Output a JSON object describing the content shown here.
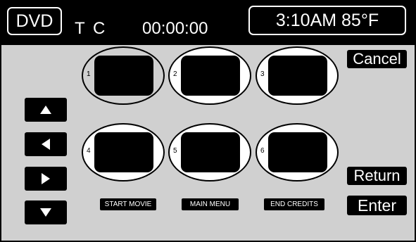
{
  "header": {
    "source_label": "DVD",
    "title_marker": "T",
    "chapter_marker": "C",
    "elapsed_time": "00:00:00",
    "clock_temperature": "3:10AM 85°F"
  },
  "buttons": {
    "cancel": "Cancel",
    "return": "Return",
    "enter": "Enter"
  },
  "arrows": [
    "up-arrow-icon",
    "left-arrow-icon",
    "right-arrow-icon",
    "down-arrow-icon"
  ],
  "chapters": [
    {
      "number": "1",
      "selected": true
    },
    {
      "number": "2",
      "selected": false
    },
    {
      "number": "3",
      "selected": false
    },
    {
      "number": "4",
      "selected": false
    },
    {
      "number": "5",
      "selected": false
    },
    {
      "number": "6",
      "selected": false
    }
  ],
  "labels": {
    "start_movie": "START MOVIE",
    "main_menu": "MAIN MENU",
    "end_credits": "END CREDITS"
  },
  "colors": {
    "panel_bg": "#e2e2e2",
    "button_bg": "#000000",
    "button_text": "#ffffff"
  }
}
